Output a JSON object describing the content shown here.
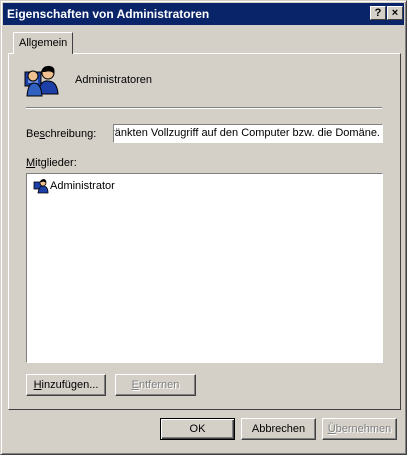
{
  "window": {
    "title": "Eigenschaften von Administratoren",
    "help_glyph": "?",
    "close_glyph": "×"
  },
  "tabs": [
    {
      "label": "Allgemein",
      "active": true
    }
  ],
  "group": {
    "name": "Administratoren",
    "icon": "users-group-icon"
  },
  "description": {
    "label_pre": "Be",
    "label_u": "s",
    "label_post": "chreibung:",
    "value": "hränkten Vollzugriff auf den Computer bzw. die Domäne."
  },
  "members": {
    "label_u": "M",
    "label_post": "itglieder:",
    "items": [
      {
        "name": "Administrator",
        "icon": "user-icon"
      }
    ]
  },
  "buttons": {
    "add": {
      "u": "H",
      "post": "inzufügen..."
    },
    "remove": {
      "u": "E",
      "post": "ntfernen"
    },
    "ok": "OK",
    "cancel": "Abbrechen",
    "apply": {
      "u": "Ü",
      "post": "bernehmen"
    }
  }
}
